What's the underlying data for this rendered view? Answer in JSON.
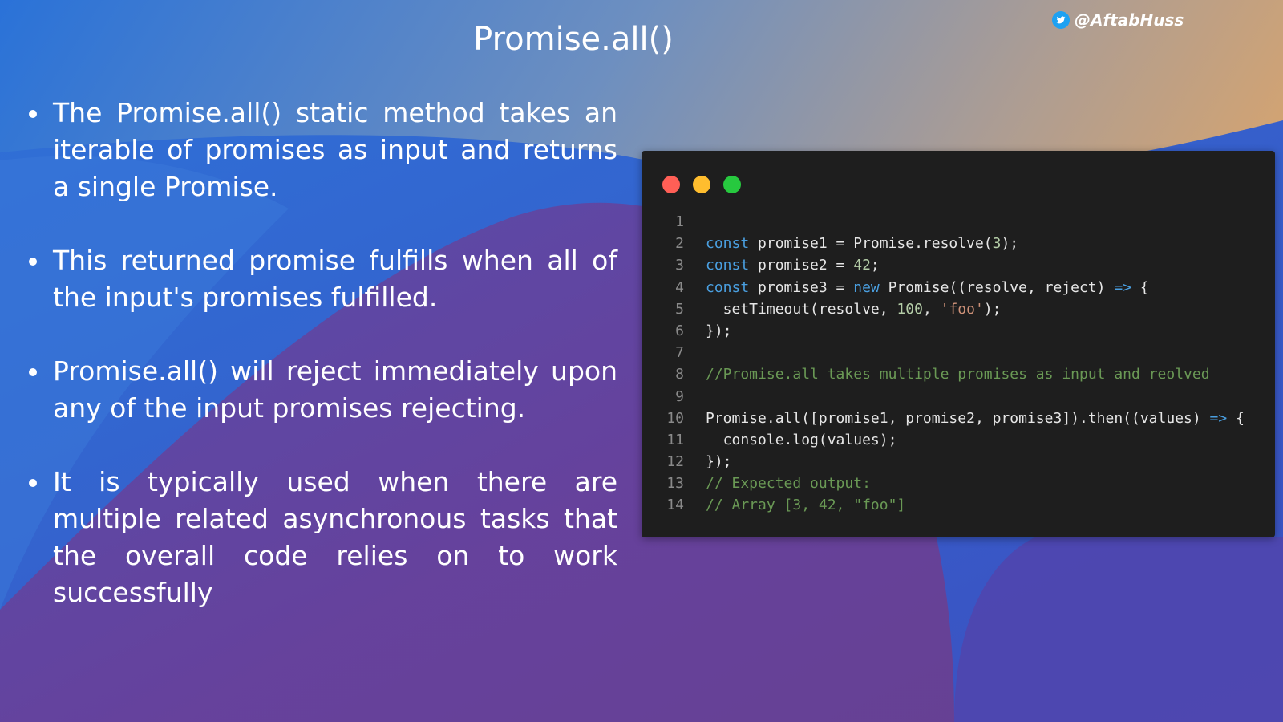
{
  "slide": {
    "title": "Promise.all()",
    "handle": "@AftabHuss",
    "handle_icon": "twitter-bird-icon"
  },
  "bullets": [
    "The Promise.all() static method takes an iterable of promises as input and returns a single Promise.",
    "This returned promise fulfills when all of the input's promises fulfilled.",
    "Promise.all() will reject immediately upon any of the input promises rejecting.",
    "It is typically used when there are multiple related asynchronous tasks that the overall code relies on to work successfully"
  ],
  "code_window": {
    "buttons": [
      "close",
      "minimize",
      "maximize"
    ],
    "line_numbers": [
      "1",
      "2",
      "3",
      "4",
      "5",
      "6",
      "7",
      "8",
      "9",
      "10",
      "11",
      "12",
      "13",
      "14"
    ],
    "lines": [
      [],
      [
        {
          "t": "const",
          "c": "kw"
        },
        {
          "t": " promise1 = Promise.resolve("
        },
        {
          "t": "3",
          "c": "num"
        },
        {
          "t": ");"
        }
      ],
      [
        {
          "t": "const",
          "c": "kw"
        },
        {
          "t": " promise2 = "
        },
        {
          "t": "42",
          "c": "num"
        },
        {
          "t": ";"
        }
      ],
      [
        {
          "t": "const",
          "c": "kw"
        },
        {
          "t": " promise3 = "
        },
        {
          "t": "new",
          "c": "kw"
        },
        {
          "t": " Promise((resolve, reject) "
        },
        {
          "t": "=>",
          "c": "ar"
        },
        {
          "t": " {"
        }
      ],
      [
        {
          "t": "  setTimeout(resolve, "
        },
        {
          "t": "100",
          "c": "num"
        },
        {
          "t": ", "
        },
        {
          "t": "'foo'",
          "c": "str"
        },
        {
          "t": ");"
        }
      ],
      [
        {
          "t": "});"
        }
      ],
      [],
      [
        {
          "t": "//Promise.all takes multiple promises as input and reolved",
          "c": "cm"
        }
      ],
      [],
      [
        {
          "t": "Promise.all([promise1, promise2, promise3]).then((values) "
        },
        {
          "t": "=>",
          "c": "ar"
        },
        {
          "t": " {"
        }
      ],
      [
        {
          "t": "  console.log(values);"
        }
      ],
      [
        {
          "t": "});"
        }
      ],
      [
        {
          "t": "// Expected output:",
          "c": "cm"
        }
      ],
      [
        {
          "t": "// Array [3, 42, \"foo\"]",
          "c": "cm"
        }
      ]
    ]
  },
  "colors": {
    "background_blue": "#2f6fd6",
    "background_purple": "#5f4499",
    "background_orange": "#d7a36e",
    "code_bg": "#1e1e1e",
    "keyword": "#4a9fe0",
    "number": "#b5cea8",
    "string": "#ce9178",
    "comment": "#6a9955"
  }
}
